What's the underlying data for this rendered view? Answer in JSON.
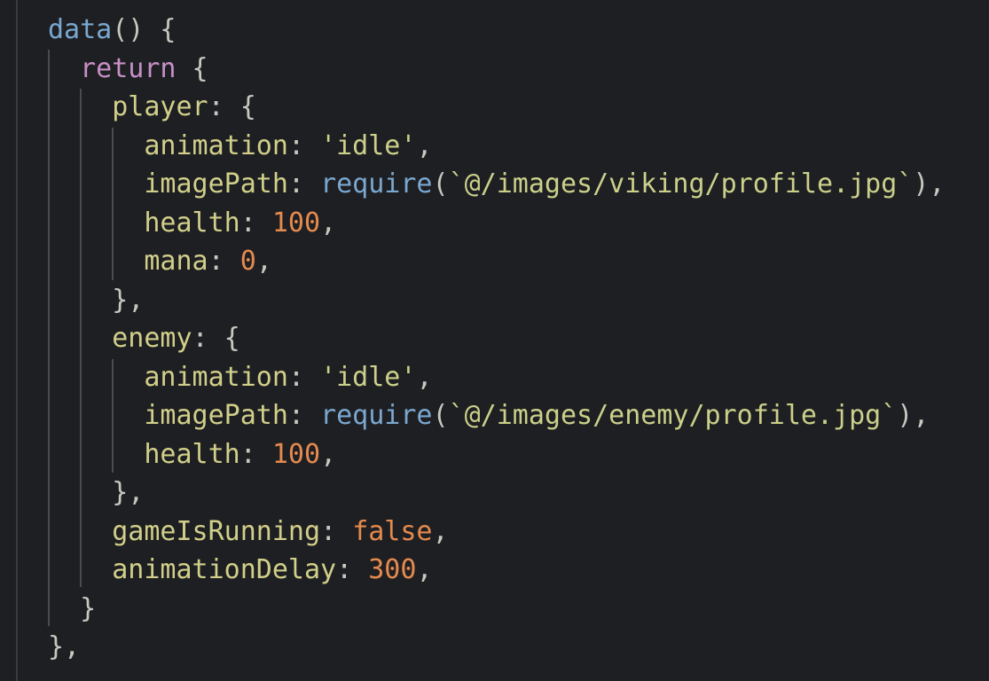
{
  "colors": {
    "background": "#1e1f22",
    "function": "#7aa8d0",
    "keyword": "#c78fc7",
    "property": "#d1cf8a",
    "string": "#cbd08a",
    "number": "#e58a4f",
    "punctuation": "#c8c8c0"
  },
  "lines": [
    [
      {
        "t": "data",
        "c": "fn"
      },
      {
        "t": "() {",
        "c": "punct"
      }
    ],
    [
      {
        "t": "  "
      },
      {
        "t": "return",
        "c": "kw"
      },
      {
        "t": " {",
        "c": "punct"
      }
    ],
    [
      {
        "t": "    "
      },
      {
        "t": "player",
        "c": "prop"
      },
      {
        "t": ": {",
        "c": "punct"
      }
    ],
    [
      {
        "t": "      "
      },
      {
        "t": "animation",
        "c": "prop"
      },
      {
        "t": ": ",
        "c": "punct"
      },
      {
        "t": "'idle'",
        "c": "str"
      },
      {
        "t": ",",
        "c": "punct"
      }
    ],
    [
      {
        "t": "      "
      },
      {
        "t": "imagePath",
        "c": "prop"
      },
      {
        "t": ": ",
        "c": "punct"
      },
      {
        "t": "require",
        "c": "req"
      },
      {
        "t": "(",
        "c": "punct"
      },
      {
        "t": "`@/images/viking/profile.jpg`",
        "c": "str"
      },
      {
        "t": "),",
        "c": "punct"
      }
    ],
    [
      {
        "t": "      "
      },
      {
        "t": "health",
        "c": "prop"
      },
      {
        "t": ": ",
        "c": "punct"
      },
      {
        "t": "100",
        "c": "num"
      },
      {
        "t": ",",
        "c": "punct"
      }
    ],
    [
      {
        "t": "      "
      },
      {
        "t": "mana",
        "c": "prop"
      },
      {
        "t": ": ",
        "c": "punct"
      },
      {
        "t": "0",
        "c": "num"
      },
      {
        "t": ",",
        "c": "punct"
      }
    ],
    [
      {
        "t": "    "
      },
      {
        "t": "},",
        "c": "punct"
      }
    ],
    [
      {
        "t": "    "
      },
      {
        "t": "enemy",
        "c": "prop"
      },
      {
        "t": ": {",
        "c": "punct"
      }
    ],
    [
      {
        "t": "      "
      },
      {
        "t": "animation",
        "c": "prop"
      },
      {
        "t": ": ",
        "c": "punct"
      },
      {
        "t": "'idle'",
        "c": "str"
      },
      {
        "t": ",",
        "c": "punct"
      }
    ],
    [
      {
        "t": "      "
      },
      {
        "t": "imagePath",
        "c": "prop"
      },
      {
        "t": ": ",
        "c": "punct"
      },
      {
        "t": "require",
        "c": "req"
      },
      {
        "t": "(",
        "c": "punct"
      },
      {
        "t": "`@/images/enemy/profile.jpg`",
        "c": "str"
      },
      {
        "t": "),",
        "c": "punct"
      }
    ],
    [
      {
        "t": "      "
      },
      {
        "t": "health",
        "c": "prop"
      },
      {
        "t": ": ",
        "c": "punct"
      },
      {
        "t": "100",
        "c": "num"
      },
      {
        "t": ",",
        "c": "punct"
      }
    ],
    [
      {
        "t": "    "
      },
      {
        "t": "},",
        "c": "punct"
      }
    ],
    [
      {
        "t": "    "
      },
      {
        "t": "gameIsRunning",
        "c": "prop"
      },
      {
        "t": ": ",
        "c": "punct"
      },
      {
        "t": "false",
        "c": "num"
      },
      {
        "t": ",",
        "c": "punct"
      }
    ],
    [
      {
        "t": "    "
      },
      {
        "t": "animationDelay",
        "c": "prop"
      },
      {
        "t": ": ",
        "c": "punct"
      },
      {
        "t": "300",
        "c": "num"
      },
      {
        "t": ",",
        "c": "punct"
      }
    ],
    [
      {
        "t": "  "
      },
      {
        "t": "}",
        "c": "punct"
      }
    ],
    [
      {
        "t": "},",
        "c": "punct"
      }
    ]
  ]
}
